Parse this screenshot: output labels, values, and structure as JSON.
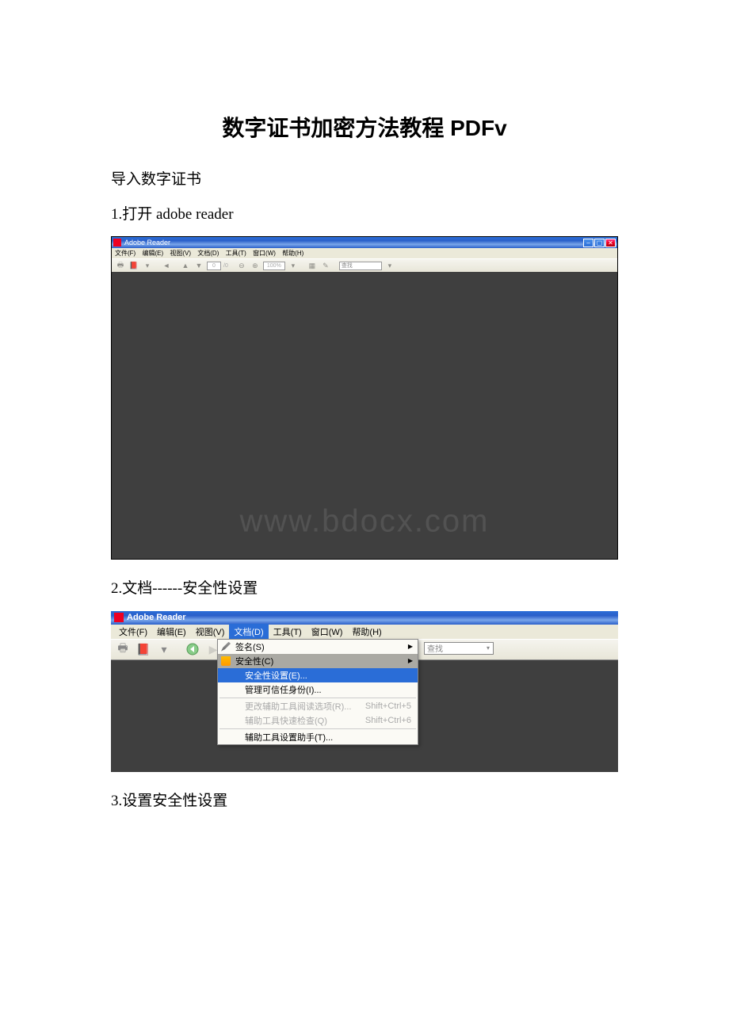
{
  "doc": {
    "title": "数字证书加密方法教程 PDFv",
    "step1_title": "导入数字证书",
    "step1_1": "1.打开 adobe reader",
    "step2": "2.文档------安全性设置",
    "step3": "3.设置安全性设置"
  },
  "shot1": {
    "title": "Adobe Reader",
    "menu": {
      "file": "文件(F)",
      "edit": "编辑(E)",
      "view": "视图(V)",
      "doc": "文档(D)",
      "tool": "工具(T)",
      "win": "窗口(W)",
      "help": "帮助(H)"
    },
    "toolbar": {
      "page": "0",
      "pagesep": "/0",
      "zoom": "100%",
      "search": "查找"
    },
    "watermark": "www.bdocx.com"
  },
  "shot2": {
    "title": "Adobe Reader",
    "menu": {
      "file": "文件(F)",
      "edit": "编辑(E)",
      "view": "视图(V)",
      "doc": "文档(D)",
      "tool": "工具(T)",
      "win": "窗口(W)",
      "help": "帮助(H)"
    },
    "search": "查找",
    "dropdown": {
      "sign": "签名(S)",
      "security": "安全性(C)",
      "secset": "安全性设置(E)...",
      "trusted": "管理可信任身份(I)...",
      "a11yopt": "更改辅助工具阅读选项(R)...",
      "a11ychk": "辅助工具快速检查(Q)",
      "short_a11yopt": "Shift+Ctrl+5",
      "short_a11ychk": "Shift+Ctrl+6",
      "a11ywiz": "辅助工具设置助手(T)..."
    }
  }
}
